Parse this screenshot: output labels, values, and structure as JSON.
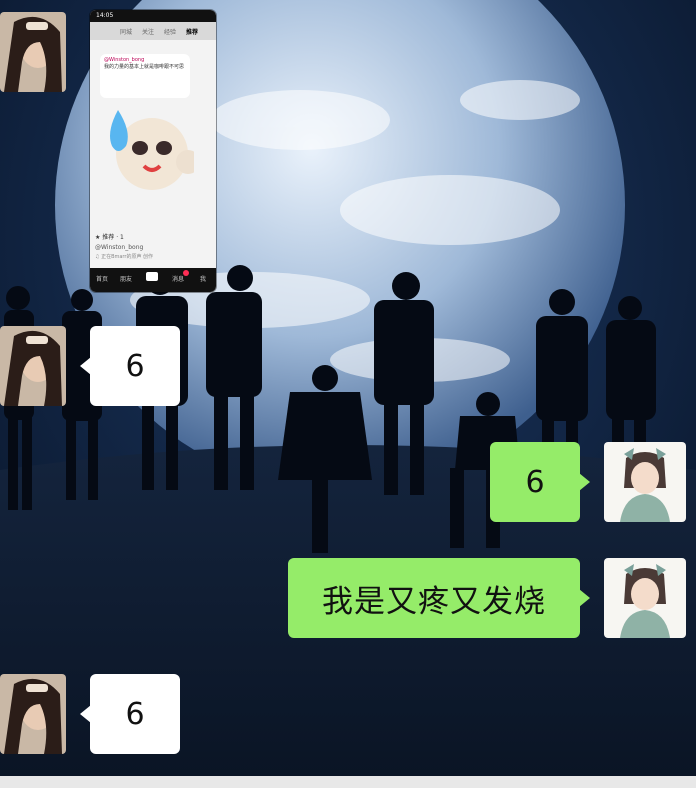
{
  "chat": {
    "messages": [
      {
        "side": "left",
        "type": "image",
        "sender": "friend"
      },
      {
        "side": "left",
        "type": "text",
        "text": "6"
      },
      {
        "side": "right",
        "type": "text",
        "text": "6"
      },
      {
        "side": "right",
        "type": "text",
        "text": "我是又疼又发烧"
      },
      {
        "side": "left",
        "type": "text",
        "text": "6"
      }
    ]
  },
  "phone_screenshot": {
    "time": "14:05",
    "nav_tabs": [
      "同城",
      "关注",
      "经验",
      "推荐"
    ],
    "active_tab": "推荐",
    "caption_user": "@Winston_bong",
    "caption_text": "我的力量的基本上就是咖啡跟不可思",
    "meta_likes": "★ 推荐 · 1",
    "meta_user": "@Winston_bong",
    "meta_music": "♫ 正在Bmarr的原声 创作",
    "bottom_nav": [
      "首页",
      "朋友",
      "消息",
      "我"
    ],
    "message_badge": "12"
  },
  "colors": {
    "sent_bubble": "#95ec69",
    "received_bubble": "#ffffff",
    "background": "#0b1a2f"
  },
  "icons": {
    "friend_avatar": "girl-photo-avatar",
    "self_avatar": "anime-girl-avatar"
  }
}
